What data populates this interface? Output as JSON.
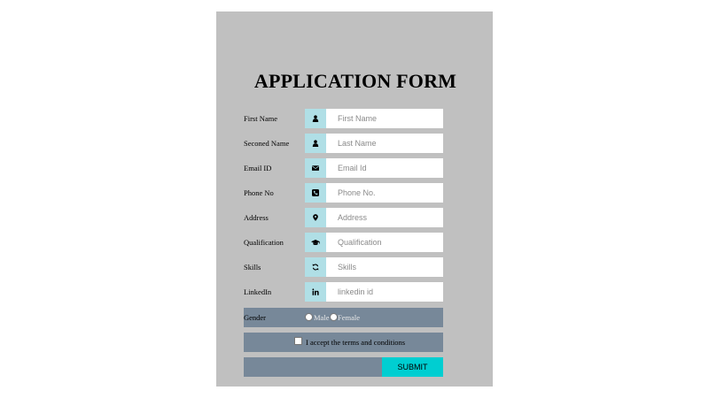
{
  "form": {
    "title": "APPLICATION FORM",
    "fields": [
      {
        "label": "First Name",
        "placeholder": "First Name",
        "icon": "user-icon"
      },
      {
        "label": "Seconed Name",
        "placeholder": "Last Name",
        "icon": "user-icon"
      },
      {
        "label": "Email ID",
        "placeholder": "Email Id",
        "icon": "envelope-icon"
      },
      {
        "label": "Phone No",
        "placeholder": "Phone No.",
        "icon": "phone-icon"
      },
      {
        "label": "Address",
        "placeholder": "Address",
        "icon": "map-marker-icon"
      },
      {
        "label": "Qualification",
        "placeholder": "Qualification",
        "icon": "graduation-cap-icon"
      },
      {
        "label": "Skills",
        "placeholder": "Skills",
        "icon": "refresh-icon"
      },
      {
        "label": "LinkedIn",
        "placeholder": "linkedin id",
        "icon": "linkedin-icon"
      }
    ],
    "gender": {
      "label": "Gender",
      "options": [
        "Male",
        "Female"
      ]
    },
    "terms": {
      "label": "I accept the terms and conditions",
      "checked": false
    },
    "submit_label": "SUBMIT"
  },
  "colors": {
    "panel_background": "#c0c0c0",
    "icon_box": "#b0dfe6",
    "bar_background": "#778899",
    "submit_button": "#00ced1"
  }
}
